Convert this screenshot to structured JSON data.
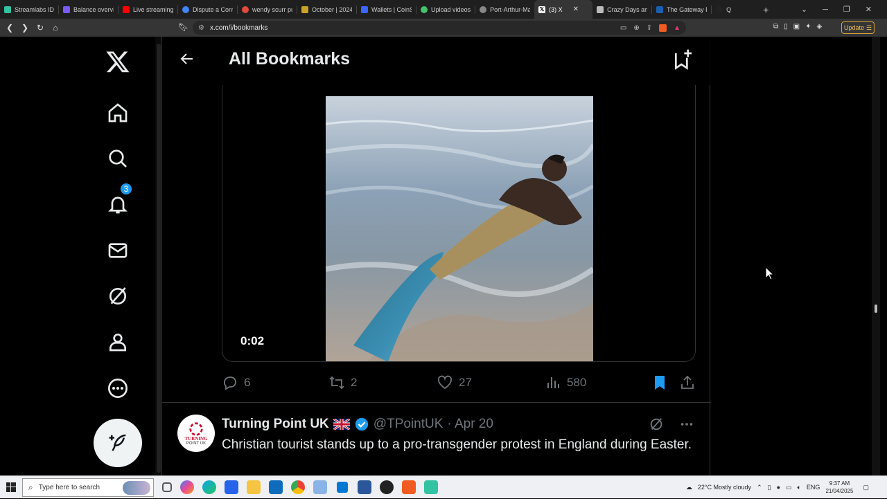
{
  "browser": {
    "tabs": [
      {
        "label": "Streamlabs ID",
        "color": "#31c3a2"
      },
      {
        "label": "Balance overvie",
        "color": "#7a5af8"
      },
      {
        "label": "Live streaming",
        "color": "#ff0000"
      },
      {
        "label": "Dispute a Cont",
        "color": "#4285f4"
      },
      {
        "label": "wendy scurr pu",
        "color": "#e04a3f"
      },
      {
        "label": "October | 2024",
        "color": "#c9a227"
      },
      {
        "label": "Wallets | CoinS",
        "color": "#3a66ff"
      },
      {
        "label": "Upload videos",
        "color": "#44c36b"
      },
      {
        "label": "Port-Arthur-Ma",
        "color": "#888888"
      },
      {
        "label": "(3) X",
        "color": "#ffffff",
        "active": true
      },
      {
        "label": "Crazy Days and",
        "color": "#bbbbbb"
      },
      {
        "label": "The Gateway P",
        "color": "#1a5fb4"
      },
      {
        "label": "Q",
        "color": "#222222"
      }
    ],
    "url": "x.com/i/bookmarks",
    "update_label": "Update"
  },
  "sidebar": {
    "notifications_count": "3"
  },
  "header": {
    "title": "All Bookmarks"
  },
  "media": {
    "timestamp": "0:02"
  },
  "actions": {
    "replies": "6",
    "reposts": "2",
    "likes": "27",
    "views": "580"
  },
  "tweet": {
    "name": "Turning Point UK",
    "handle": "@TPointUK",
    "date": "· Apr 20",
    "text": "Christian tourist stands up to a pro-transgender protest in England during Easter.",
    "avatar_line1": "TURNING",
    "avatar_line2": "POINT UK"
  },
  "taskbar": {
    "search_placeholder": "Type here to search",
    "weather": "22°C  Mostly cloudy",
    "language": "ENG",
    "time": "9:37 AM",
    "date": "21/04/2025"
  },
  "colors": {
    "accent": "#1d9bf0",
    "background": "#000000",
    "border": "#2f3336"
  }
}
